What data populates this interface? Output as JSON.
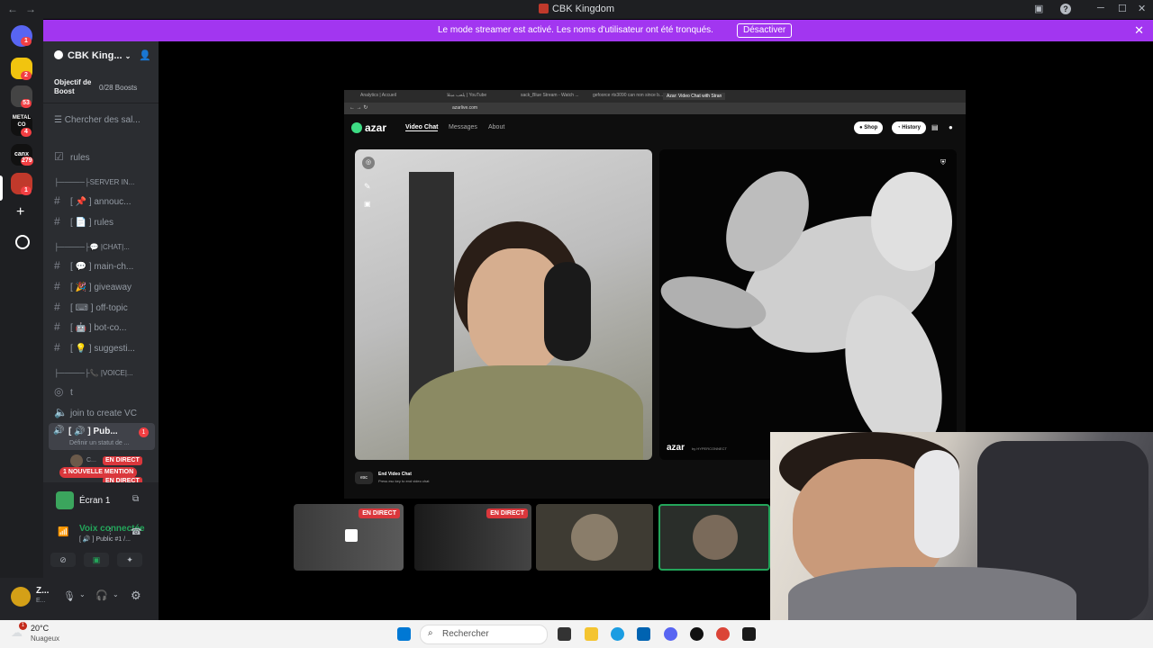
{
  "window": {
    "title": "CBK Kingdom"
  },
  "banner": {
    "message": "Le mode streamer est activé. Les noms d'utilisateur ont été tronqués.",
    "button": "Désactiver"
  },
  "servers": [
    {
      "name": "discord-home",
      "badge": "1",
      "color": "#5865f2"
    },
    {
      "name": "server-2",
      "badge": "2",
      "color": "#f1c40f"
    },
    {
      "name": "server-3",
      "badge": "53",
      "color": "#444"
    },
    {
      "name": "server-metal",
      "badge": "4",
      "color": "#111"
    },
    {
      "name": "server-canx",
      "badge": "279",
      "color": "#111"
    },
    {
      "name": "server-cbk",
      "badge": "1",
      "color": "#c0392b"
    }
  ],
  "server_labels": {
    "metal": "METAL CO",
    "canx": "canx"
  },
  "sidebar": {
    "guild_name": "CBK King...",
    "boost_label": "Objectif de Boost",
    "boost_value": "0/28 Boosts",
    "browse": "Chercher des sal...",
    "rules_top": "rules",
    "cat_server": "├─────├SERVER IN...",
    "announce": "[ 📌 ] annouc...",
    "rules": "[ 📄 ] rules",
    "cat_chat": "├─────├💬 |CHAT|...",
    "main_chat": "[ 💬 ] main-ch...",
    "giveaway": "[ 🎉 ] giveaway",
    "off_topic": "[ ⌨ ] off-topic",
    "bot_commands": "[ 🤖 ] bot-co...",
    "suggestions": "[ 💡 ] suggesti...",
    "cat_voice": "├─────├📞 |VOICE|...",
    "voice_t": "t",
    "join_vc": "join to create VC",
    "public_channel": "[ 🔊 ] Pub...",
    "public_badge": "1",
    "public_status": "Définir un statut de ...",
    "live_badge": "EN DIRECT",
    "mention_badge": "1 NOUVELLE MENTION",
    "live_badge_2": "EN DIRECT",
    "user_partial": "C..."
  },
  "userpanel": {
    "screen_title": "Écran 1",
    "voice_status": "Voix connectée",
    "voice_channel": "[ 🔊 ] Public #1 /...",
    "username": "Z...",
    "user_sub": "E..."
  },
  "browser": {
    "tabs": [
      "Analytics | Accueil",
      "يلعب مبتلا | YouTube",
      "sack_Blue Stream - Watch ...",
      "gefoorce rtx3090 can non since b...",
      "Azar: Video Chat with Stran"
    ],
    "url": "azarlive.com",
    "nav": {
      "video_chat": "Video Chat",
      "messages": "Messages",
      "about": "About"
    },
    "shop": "Shop",
    "history": "History",
    "logo": "azar",
    "end_key": "esc",
    "end_title": "End Video Chat",
    "end_sub": "Press esc key to end video chat",
    "overlay_logo": "azar",
    "overlay_sub": "by HYPERCONNECT"
  },
  "thumbnails": {
    "live_1": "EN DIRECT",
    "live_2": "EN DIRECT"
  },
  "taskbar": {
    "temp": "20°C",
    "weather": "Nuageux",
    "search": "Rechercher",
    "notif_badge": "1"
  }
}
